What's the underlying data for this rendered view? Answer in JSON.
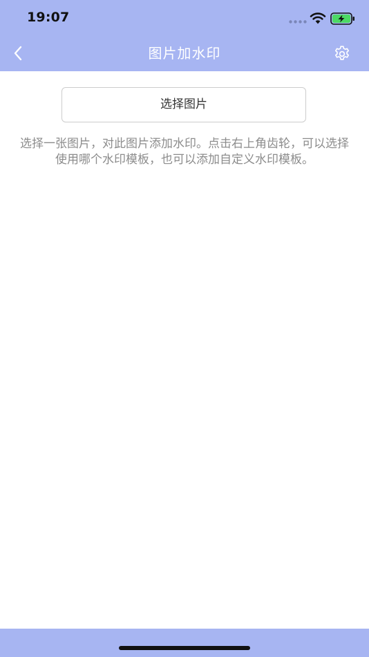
{
  "status_bar": {
    "time": "19:07"
  },
  "nav": {
    "title": "图片加水印",
    "back_icon": "chevron-left-icon",
    "settings_icon": "gear-icon"
  },
  "main": {
    "select_button_label": "选择图片",
    "description": "选择一张图片，对此图片添加水印。点击右上角齿轮，可以选择使用哪个水印模板，也可以添加自定义水印模板。"
  },
  "colors": {
    "accent": "#a7b5f2",
    "background": "#ffffff",
    "description_text": "#8c8c8c",
    "button_text": "#333333",
    "battery": "#4cd964"
  }
}
